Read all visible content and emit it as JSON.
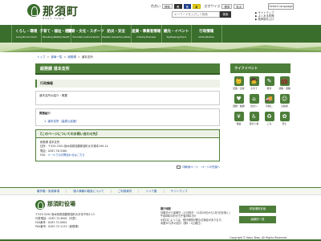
{
  "header": {
    "logo_text": "那須町",
    "logo_sub": "NASU TOWN",
    "color_label": "色合い",
    "color_std": "標準",
    "color_b": "黒",
    "color_y": "青",
    "color_z": "黄",
    "size_label": "文字サイズ",
    "size_std": "標準",
    "size_large": "拡大",
    "lang": "Select Language",
    "search_placeholder": "キーワードを入力して検索",
    "search_btn": "検索",
    "side_links": [
      "▶ サイトマップ",
      "▶ よくある質問",
      "▶ 音声読み上げ"
    ]
  },
  "nav": [
    {
      "jp": "くらし・環境",
      "en": "Living,Environment"
    },
    {
      "jp": "子育て・福祉・健康",
      "en": "Parenting,Welfare,Health"
    },
    {
      "jp": "教育・文化・スポーツ",
      "en": "Education,Culture,Sports"
    },
    {
      "jp": "防災・安全",
      "en": "Disaster prevention,safety"
    },
    {
      "jp": "産業・事業者情報",
      "en": "Industry,Business"
    },
    {
      "jp": "観光・イベント",
      "en": "Sightseeing,Event"
    },
    {
      "jp": "行政情報",
      "en": "Administration"
    }
  ],
  "breadcrumb": [
    "トップ",
    "部局一覧",
    "総務課",
    "道本支所"
  ],
  "main": {
    "title": "総務課 道本支所",
    "section1": "行政情報",
    "box1": "道本支所の紹介・概要",
    "box2_title": "関連紹介",
    "box2_link": "1. 道本支所（高原公民館）",
    "contact_head": "【このページについてのお問い合わせ先】",
    "contact_lines": [
      "総務課 道本支所",
      "住所：〒329-3301 栃木県那須郡那須町大字湯本199-14",
      "電話：0287-76-3160",
      "FAX："
    ],
    "contact_link": "メールでのお問合わせはこちら",
    "bottom_links": [
      "印刷用ページ",
      "ページの先頭へ"
    ]
  },
  "sidebar": {
    "head": "ライフイベント",
    "items": [
      {
        "label": "妊娠・出産",
        "icon": "👶"
      },
      {
        "label": "子育て",
        "icon": "🧒"
      },
      {
        "label": "教育",
        "icon": "✎"
      },
      {
        "label": "就職・退職",
        "icon": "💼"
      },
      {
        "label": "結婚・離婚",
        "icon": "♥"
      },
      {
        "label": "住まい",
        "icon": "⌂"
      },
      {
        "label": "引越し",
        "icon": "🚚"
      },
      {
        "label": "高齢者",
        "icon": "☺"
      },
      {
        "label": "税金",
        "icon": "¥"
      },
      {
        "label": "障がい者",
        "icon": "♿"
      },
      {
        "label": "ごみ",
        "icon": "♻"
      },
      {
        "label": "死亡",
        "icon": "✿"
      }
    ]
  },
  "footer": {
    "links": [
      "著作権・免責事項",
      "個人情報の取扱について",
      "ご利用案内",
      "リンク集",
      "サイトマップ"
    ],
    "logo": "那須町役場",
    "addr": [
      "〒329-3292 栃木県那須郡那須町大字寺子丙3-13",
      "代表電話：0287-72-6901（代表）",
      "FAX番号：0287-72-0904",
      "PAX番号：0287-72-1133（総務課）"
    ],
    "hours_title": "開庁時間",
    "hours": [
      "月曜日から金曜日（土日祝日・12月29日から1月3日を除く）",
      "午前8時30分から午後5時15分",
      "※窓口によっては、受付時間が異なる場合があります。",
      "本館2F以外の窓口（第2・4土曜日）"
    ],
    "btn1": "町役場所在地",
    "btn2": "組織別一覧",
    "copyright": "Copyright © Nasu Town, All Rights Reserved."
  },
  "colors": {
    "brand": "#3a6e2c",
    "accent": "#4d7e39",
    "link": "#1e4fa3"
  }
}
